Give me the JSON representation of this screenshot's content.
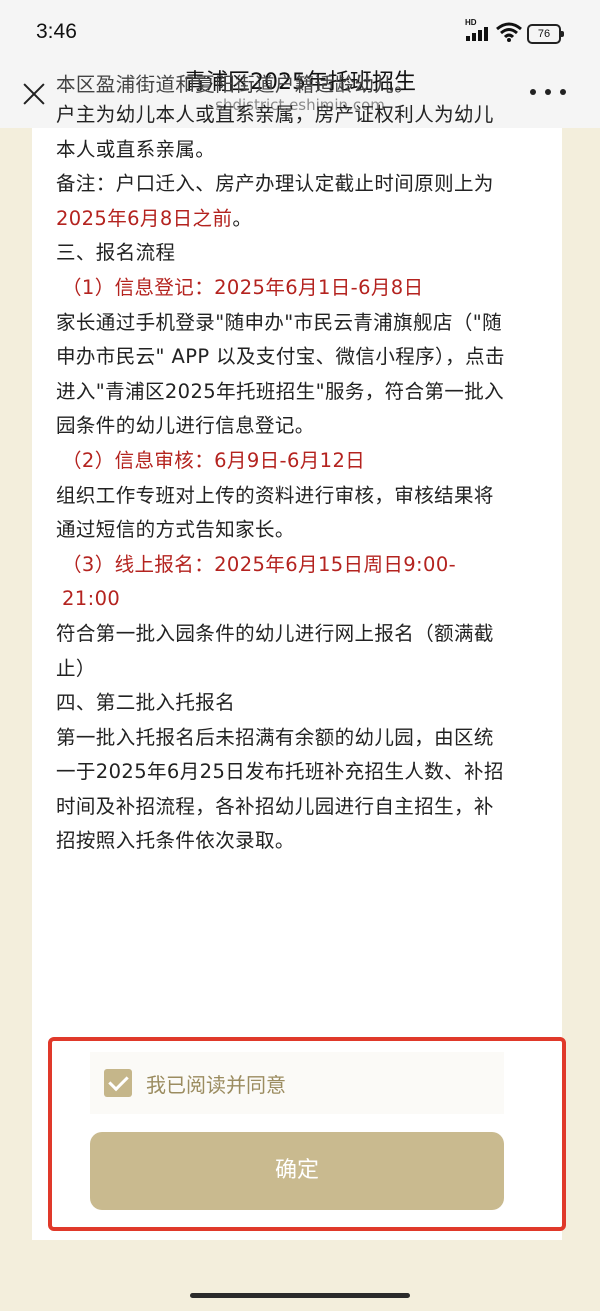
{
  "status_bar": {
    "time": "3:46",
    "signal_label": "HD",
    "battery": "76"
  },
  "nav": {
    "title": "青浦区2025年托班招生",
    "subtitle": "shdistrict.eshimin.com",
    "close_icon": "close-icon",
    "more_icon": "more-icon"
  },
  "content": {
    "line_cut": "本区盈浦街道和夏阳街道户籍适龄幼儿。",
    "para_owner": "户主为幼儿本人或直系亲属，房产证权利人为幼儿本人或直系亲属。",
    "note_prefix": "备注：户口迁入、房产办理认定截止时间原则上为",
    "note_highlight": "2025年6月8日之前",
    "note_suffix": "。",
    "section3": "三、报名流程",
    "step1_title": "（1）信息登记：2025年6月1日-6月8日",
    "step1_body": "家长通过手机登录\"随申办\"市民云青浦旗舰店（\"随申办市民云\" APP 以及支付宝、微信小程序），点击进入\"青浦区2025年托班招生\"服务，符合第一批入园条件的幼儿进行信息登记。",
    "step2_title": "（2）信息审核：6月9日-6月12日",
    "step2_body": "组织工作专班对上传的资料进行审核，审核结果将通过短信的方式告知家长。",
    "step3_title": "（3）线上报名：2025年6月15日周日9:00-21:00",
    "step3_body": "符合第一批入园条件的幼儿进行网上报名（额满截止）",
    "section4": "四、第二批入托报名",
    "section4_body": "第一批入托报名后未招满有余额的幼儿园，由区统一于2025年6月25日发布托班补充招生人数、补招时间及补招流程，各补招幼儿园进行自主招生，补招按照入托条件依次录取。"
  },
  "agreement": {
    "checked": true,
    "label": "我已阅读并同意"
  },
  "confirm": {
    "label": "确定"
  },
  "colors": {
    "accent_red": "#b4231f",
    "button_gold": "#c9ba8f",
    "highlight_border": "#e0392a"
  }
}
